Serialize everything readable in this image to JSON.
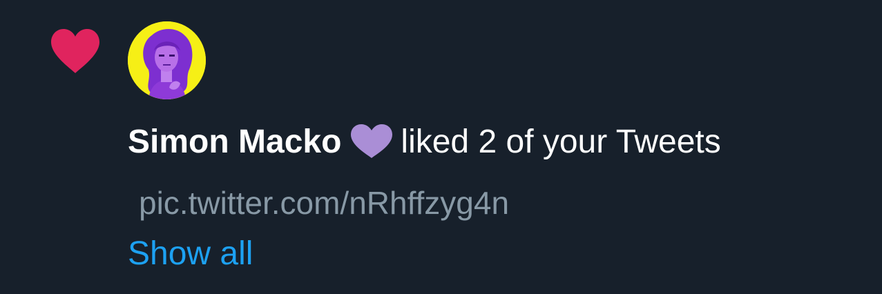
{
  "notification": {
    "type_icon": "heart-icon",
    "type_icon_color": "#e0245e",
    "avatar_icon": "avatar-portrait",
    "user_name": "Simon Macko",
    "name_emoji": "purple-heart-icon",
    "name_emoji_color": "#aa8ed6",
    "action_text": "liked 2 of your Tweets",
    "tweet_link": "pic.twitter.com/nRhffzyg4n",
    "show_all_label": "Show all"
  },
  "colors": {
    "background": "#17202b",
    "text_primary": "#ffffff",
    "text_secondary": "#8899a6",
    "link": "#1da1f2",
    "avatar_background": "#f6ef16"
  }
}
